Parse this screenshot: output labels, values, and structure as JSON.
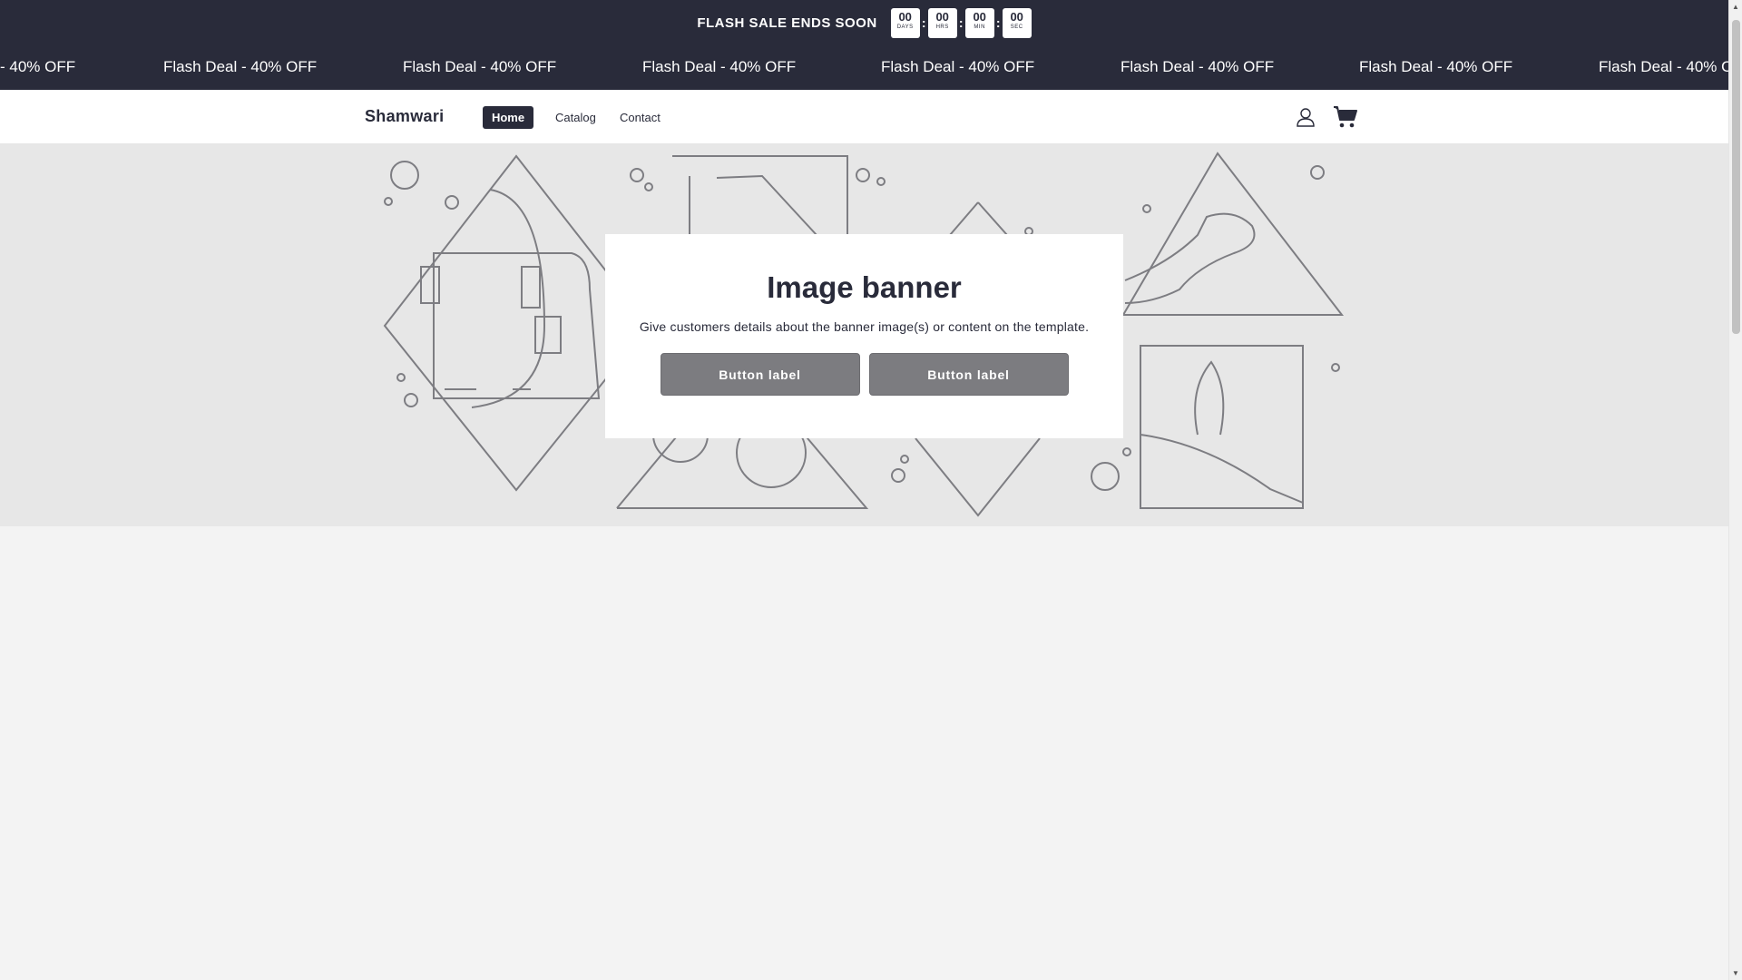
{
  "announcement": {
    "sale_title": "FLASH SALE ENDS SOON",
    "countdown": [
      {
        "value": "00",
        "unit": "DAYS"
      },
      {
        "value": "00",
        "unit": "HRS"
      },
      {
        "value": "00",
        "unit": "MIN"
      },
      {
        "value": "00",
        "unit": "SEC"
      }
    ],
    "separator": ":",
    "marquee_items": [
      "- 40% OFF",
      "Flash Deal - 40% OFF",
      "Flash Deal - 40% OFF",
      "Flash Deal - 40% OFF",
      "Flash Deal - 40% OFF",
      "Flash Deal - 40% OFF",
      "Flash Deal - 40% OFF",
      "Flash Deal - 40% O"
    ]
  },
  "header": {
    "logo": "Shamwari",
    "nav": [
      "Home",
      "Catalog",
      "Contact"
    ],
    "icons": [
      "account-icon",
      "cart-icon"
    ]
  },
  "banner": {
    "heading": "Image banner",
    "text": "Give customers details about the banner image(s) or content on the template.",
    "button_1": "Button label",
    "button_2": "Button label"
  },
  "colors": {
    "dark": "#292b3a",
    "button": "#7c7c80",
    "banner_bg": "#e7e7e7",
    "page_bg": "#f3f3f3"
  }
}
